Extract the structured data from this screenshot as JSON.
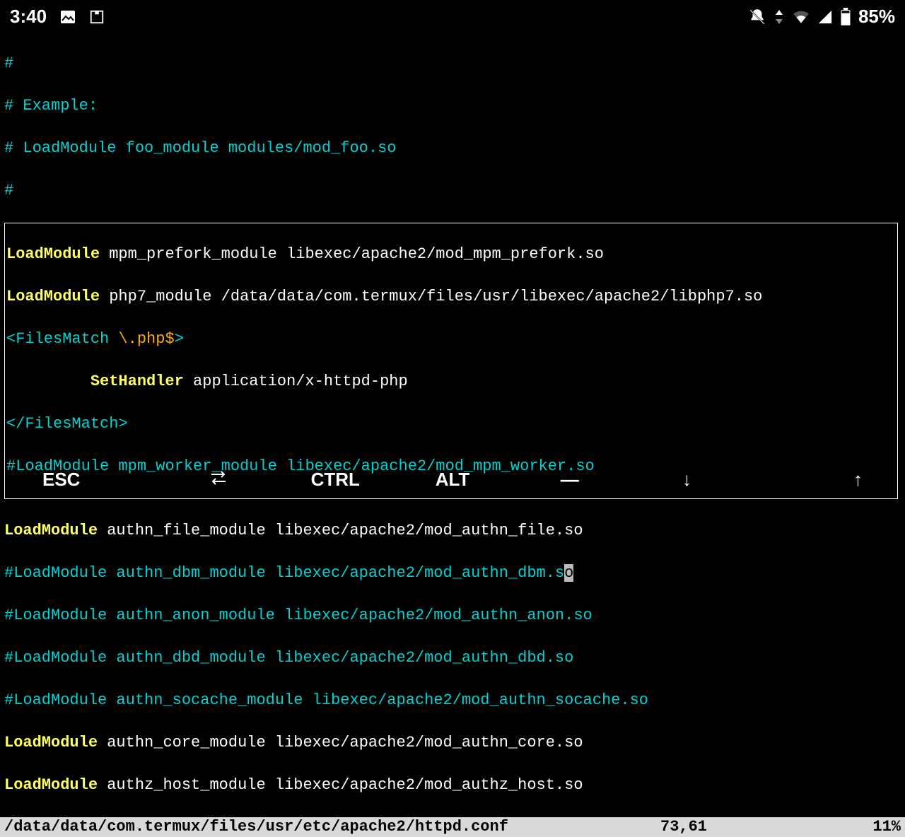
{
  "status": {
    "time": "3:40",
    "battery": "85%"
  },
  "lines": {
    "l0": "#",
    "l1": "# Example:",
    "l2": "# LoadModule foo_module modules/mod_foo.so",
    "l3": "#",
    "l4a": "LoadModule",
    "l4b": " mpm_prefork_module libexec/apache2/mod_mpm_prefork.so",
    "l5a": "LoadModule",
    "l5b": " php7_module /data/data/com.termux/files/usr/libexec/apache2/libphp7.so",
    "l6a": "<FilesMatch ",
    "l6b": "\\.php$",
    "l6c": ">",
    "l7a": "         SetHandler",
    "l7b": " application/x-httpd-php",
    "l8": "</FilesMatch>",
    "l9": "#LoadModule mpm_worker_module libexec/apache2/mod_mpm_worker.so",
    "l10a": "LoadModule",
    "l10b": " authn_file_module libexec/apache2/mod_authn_file.so",
    "l11a": "#LoadModule authn_dbm_module libexec/apache2/mod_authn_dbm.s",
    "l11b": "o",
    "l12": "#LoadModule authn_anon_module libexec/apache2/mod_authn_anon.so",
    "l13": "#LoadModule authn_dbd_module libexec/apache2/mod_authn_dbd.so",
    "l14": "#LoadModule authn_socache_module libexec/apache2/mod_authn_socache.so",
    "l15a": "LoadModule",
    "l15b": " authn_core_module libexec/apache2/mod_authn_core.so",
    "l16a": "LoadModule",
    "l16b": " authz_host_module libexec/apache2/mod_authz_host.so"
  },
  "statusline": {
    "file": "/data/data/com.termux/files/usr/etc/apache2/httpd.conf",
    "pos": "73,61",
    "pct": "11%"
  },
  "keys": {
    "esc": "ESC",
    "ctrl": "CTRL",
    "alt": "ALT",
    "dash": "—",
    "down": "↓",
    "up": "↑"
  }
}
